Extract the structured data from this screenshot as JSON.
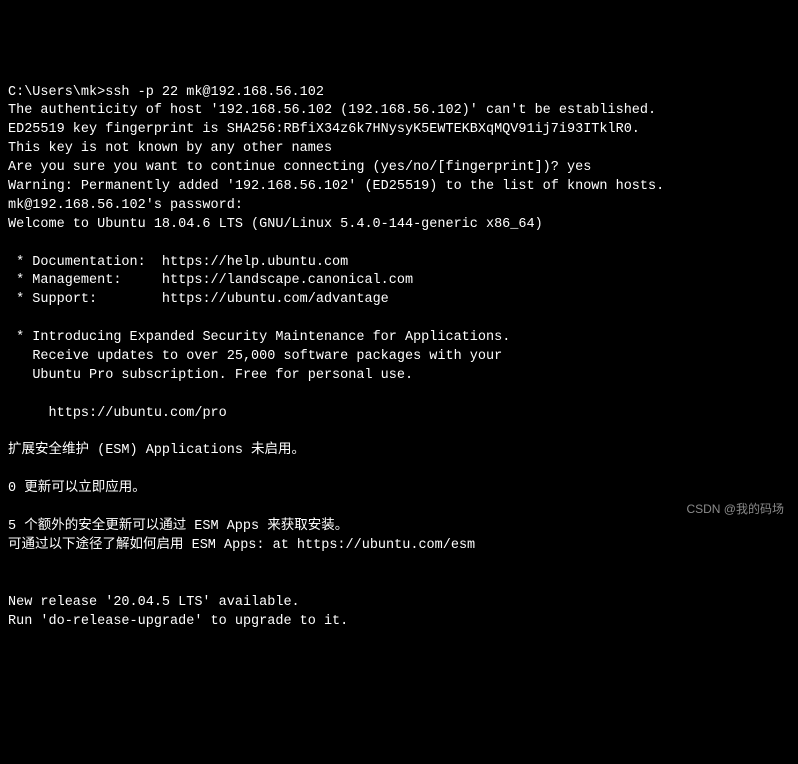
{
  "terminal": {
    "lines": [
      "C:\\Users\\mk>ssh -p 22 mk@192.168.56.102",
      "The authenticity of host '192.168.56.102 (192.168.56.102)' can't be established.",
      "ED25519 key fingerprint is SHA256:RBfiX34z6k7HNysyK5EWTEKBXqMQV91ij7i93ITklR0.",
      "This key is not known by any other names",
      "Are you sure you want to continue connecting (yes/no/[fingerprint])? yes",
      "Warning: Permanently added '192.168.56.102' (ED25519) to the list of known hosts.",
      "mk@192.168.56.102's password:",
      "Welcome to Ubuntu 18.04.6 LTS (GNU/Linux 5.4.0-144-generic x86_64)",
      "",
      " * Documentation:  https://help.ubuntu.com",
      " * Management:     https://landscape.canonical.com",
      " * Support:        https://ubuntu.com/advantage",
      "",
      " * Introducing Expanded Security Maintenance for Applications.",
      "   Receive updates to over 25,000 software packages with your",
      "   Ubuntu Pro subscription. Free for personal use.",
      "",
      "     https://ubuntu.com/pro",
      "",
      "扩展安全维护 (ESM) Applications 未启用。",
      "",
      "0 更新可以立即应用。",
      "",
      "5 个额外的安全更新可以通过 ESM Apps 来获取安装。",
      "可通过以下途径了解如何启用 ESM Apps: at https://ubuntu.com/esm",
      "",
      "",
      "New release '20.04.5 LTS' available.",
      "Run 'do-release-upgrade' to upgrade to it."
    ]
  },
  "watermark": "CSDN @我的码场"
}
